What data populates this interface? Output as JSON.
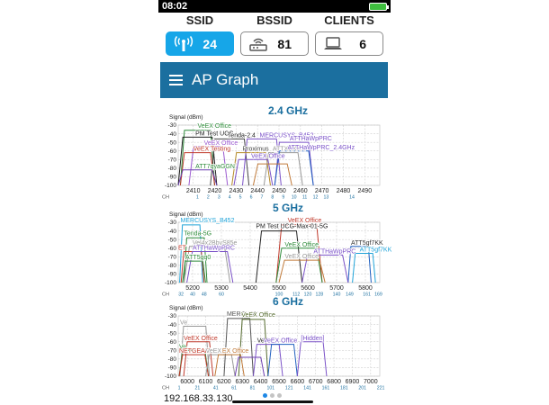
{
  "status": {
    "time": "08:02"
  },
  "counters": [
    {
      "title": "SSID",
      "value": "24",
      "icon": "wifi-signal-icon"
    },
    {
      "title": "BSSID",
      "value": "81",
      "icon": "router-icon"
    },
    {
      "title": "CLIENTS",
      "value": "6",
      "icon": "laptop-icon"
    }
  ],
  "appbar": {
    "title": "AP Graph",
    "menu_icon": "hamburger-menu-icon"
  },
  "colors": {
    "accent": "#16a6e8",
    "appbar": "#1b6f9f",
    "grid": "#cfcfcf"
  },
  "graphs": [
    {
      "title": "2.4 GHz",
      "y_label": "Signal (dBm)",
      "ch_label": "CH",
      "y_ticks": [
        "-30",
        "-40",
        "-50",
        "-60",
        "-70",
        "-80",
        "-90",
        "-100"
      ],
      "x_ticks": [
        "2410",
        "2420",
        "2430",
        "2440",
        "2450",
        "2460",
        "2470",
        "2480",
        "2490"
      ],
      "x_min": 2403,
      "x_max": 2497,
      "x_tick_values": [
        2410,
        2420,
        2430,
        2440,
        2450,
        2460,
        2470,
        2480,
        2490
      ],
      "channels": [
        "1",
        "2",
        "3",
        "4",
        "5",
        "6",
        "7",
        "8",
        "9",
        "10",
        "11",
        "12",
        "13",
        "14"
      ],
      "channel_values": [
        2412,
        2417,
        2422,
        2427,
        2432,
        2437,
        2442,
        2447,
        2452,
        2457,
        2462,
        2467,
        2472,
        2484
      ],
      "labels": [
        {
          "text": "VeEX Office",
          "freq": 2412,
          "dbm": -33,
          "color": "#2e8b3a"
        },
        {
          "text": "PM Test UCG",
          "freq": 2411,
          "dbm": -42,
          "color": "#222222"
        },
        {
          "text": "Tenda-2.4",
          "freq": 2426,
          "dbm": -44,
          "color": "#222222"
        },
        {
          "text": "MERCUSYS_B452",
          "freq": 2441,
          "dbm": -44,
          "color": "#7b52c8"
        },
        {
          "text": "ATTHaWpPRC",
          "freq": 2455,
          "dbm": -48,
          "color": "#7b52c8"
        },
        {
          "text": "VeEX Office",
          "freq": 2415,
          "dbm": -53,
          "color": "#9b59d0"
        },
        {
          "text": "VeEX Testing",
          "freq": 2410,
          "dbm": -60,
          "color": "#c0392b"
        },
        {
          "text": "Proximus",
          "freq": 2433,
          "dbm": -60,
          "color": "#444444"
        },
        {
          "text": "ATTXXXXX",
          "freq": 2447,
          "dbm": -60,
          "color": "#999999"
        },
        {
          "text": "ATTHaWpPRC_2.4GHz",
          "freq": 2454,
          "dbm": -58,
          "color": "#7b52c8"
        },
        {
          "text": "VeEX Office",
          "freq": 2437,
          "dbm": -68,
          "color": "#7b52c8"
        },
        {
          "text": "ATT7qyaGGN",
          "freq": 2411,
          "dbm": -80,
          "color": "#2e8b3a"
        }
      ],
      "curves": [
        {
          "f1": 2404,
          "f2": 2420,
          "dbm": -36,
          "color": "#2e8b3a"
        },
        {
          "f1": 2403,
          "f2": 2421,
          "dbm": -44,
          "color": "#222222"
        },
        {
          "f1": 2418,
          "f2": 2436,
          "dbm": -46,
          "color": "#444444"
        },
        {
          "f1": 2433,
          "f2": 2451,
          "dbm": -46,
          "color": "#7b52c8"
        },
        {
          "f1": 2448,
          "f2": 2466,
          "dbm": -50,
          "color": "#7b52c8"
        },
        {
          "f1": 2408,
          "f2": 2426,
          "dbm": -55,
          "color": "#9b59d0"
        },
        {
          "f1": 2404,
          "f2": 2420,
          "dbm": -62,
          "color": "#c0392b"
        },
        {
          "f1": 2428,
          "f2": 2446,
          "dbm": -62,
          "color": "#b58b2a"
        },
        {
          "f1": 2443,
          "f2": 2461,
          "dbm": -62,
          "color": "#999999"
        },
        {
          "f1": 2448,
          "f2": 2466,
          "dbm": -60,
          "color": "#1f5fbf"
        },
        {
          "f1": 2429,
          "f2": 2447,
          "dbm": -70,
          "color": "#7b52c8"
        },
        {
          "f1": 2403,
          "f2": 2421,
          "dbm": -82,
          "color": "#6c3fb0"
        },
        {
          "f1": 2438,
          "f2": 2456,
          "dbm": -75,
          "color": "#c07a3a"
        }
      ]
    },
    {
      "title": "5 GHz",
      "y_label": "Signal (dBm)",
      "ch_label": "CH",
      "y_ticks": [
        "-30",
        "-40",
        "-50",
        "-60",
        "-70",
        "-80",
        "-90",
        "-100"
      ],
      "x_ticks": [
        "5200",
        "5300",
        "5400",
        "5500",
        "5600",
        "5700",
        "5800"
      ],
      "x_min": 5150,
      "x_max": 5850,
      "x_tick_values": [
        5200,
        5300,
        5400,
        5500,
        5600,
        5700,
        5800
      ],
      "channels": [
        "32",
        "40",
        "48",
        "60",
        "100",
        "112",
        "120",
        "128",
        "140",
        "149",
        "161",
        "169"
      ],
      "channel_values": [
        5160,
        5200,
        5240,
        5300,
        5500,
        5560,
        5600,
        5640,
        5700,
        5745,
        5805,
        5845
      ],
      "labels": [
        {
          "text": "MERCUSYS_B452",
          "freq": 5158,
          "dbm": -30,
          "color": "#1fa3d8"
        },
        {
          "text": "VeEX Office",
          "freq": 5530,
          "dbm": -30,
          "color": "#c0392b"
        },
        {
          "text": "PM Test UCG-Max-01-5G",
          "freq": 5420,
          "dbm": -37,
          "color": "#222222"
        },
        {
          "text": "Tenda-5G",
          "freq": 5170,
          "dbm": -45,
          "color": "#2e8b3a"
        },
        {
          "text": "Vel4x2BbvS85e",
          "freq": 5200,
          "dbm": -56,
          "color": "#999999"
        },
        {
          "text": "VeEX Office",
          "freq": 5520,
          "dbm": -58,
          "color": "#2e8b3a"
        },
        {
          "text": "ATT5gf7KK",
          "freq": 5750,
          "dbm": -56,
          "color": "#333333"
        },
        {
          "text": "ET",
          "freq": 5150,
          "dbm": -62,
          "color": "#c0392b"
        },
        {
          "text": "ATTHaWpPRC",
          "freq": 5200,
          "dbm": -62,
          "color": "#7b52c8"
        },
        {
          "text": "ATTHaWpPRC",
          "freq": 5620,
          "dbm": -66,
          "color": "#7b52c8"
        },
        {
          "text": "VeEX Office",
          "freq": 5520,
          "dbm": -72,
          "color": "#999999"
        },
        {
          "text": "ATT5gf7KK",
          "freq": 5780,
          "dbm": -64,
          "color": "#1fa3d8"
        },
        {
          "text": "ATT5gq0",
          "freq": 5175,
          "dbm": -73,
          "color": "#2e8b3a"
        }
      ],
      "curves": [
        {
          "f1": 5155,
          "f2": 5235,
          "dbm": -33,
          "color": "#1fa3d8"
        },
        {
          "f1": 5490,
          "f2": 5650,
          "dbm": -33,
          "color": "#c0392b"
        },
        {
          "f1": 5420,
          "f2": 5580,
          "dbm": -40,
          "color": "#222222"
        },
        {
          "f1": 5170,
          "f2": 5250,
          "dbm": -48,
          "color": "#2e8b3a"
        },
        {
          "f1": 5170,
          "f2": 5330,
          "dbm": -58,
          "color": "#999999"
        },
        {
          "f1": 5490,
          "f2": 5650,
          "dbm": -60,
          "color": "#2e8b3a"
        },
        {
          "f1": 5740,
          "f2": 5820,
          "dbm": -58,
          "color": "#1f5fbf"
        },
        {
          "f1": 5160,
          "f2": 5240,
          "dbm": -64,
          "color": "#c0392b"
        },
        {
          "f1": 5180,
          "f2": 5340,
          "dbm": -64,
          "color": "#7b52c8"
        },
        {
          "f1": 5580,
          "f2": 5740,
          "dbm": -68,
          "color": "#7b52c8"
        },
        {
          "f1": 5500,
          "f2": 5660,
          "dbm": -74,
          "color": "#c07a3a"
        },
        {
          "f1": 5755,
          "f2": 5835,
          "dbm": -66,
          "color": "#1fa3d8"
        },
        {
          "f1": 5165,
          "f2": 5245,
          "dbm": -75,
          "color": "#2e8b3a"
        }
      ]
    },
    {
      "title": "6 GHz",
      "y_label": "Signal (dBm)",
      "ch_label": "CH",
      "y_ticks": [
        "-30",
        "-40",
        "-50",
        "-60",
        "-70",
        "-80",
        "-90",
        "-100"
      ],
      "x_ticks": [
        "6000",
        "6100",
        "6200",
        "6300",
        "6400",
        "6500",
        "6600",
        "6700",
        "6800",
        "6900",
        "7000"
      ],
      "x_min": 5950,
      "x_max": 7050,
      "x_tick_values": [
        6000,
        6100,
        6200,
        6300,
        6400,
        6500,
        6600,
        6700,
        6800,
        6900,
        7000
      ],
      "channels": [
        "1",
        "21",
        "41",
        "61",
        "81",
        "101",
        "121",
        "141",
        "161",
        "181",
        "201",
        "221"
      ],
      "channel_values": [
        5955,
        6055,
        6155,
        6255,
        6355,
        6455,
        6555,
        6655,
        6755,
        6855,
        6955,
        7055
      ],
      "labels": [
        {
          "text": "MERCUSY",
          "freq": 6215,
          "dbm": -30,
          "color": "#555555"
        },
        {
          "text": "VeEX Office",
          "freq": 6295,
          "dbm": -31,
          "color": "#556b2f"
        },
        {
          "text": "Ve",
          "freq": 5960,
          "dbm": -40,
          "color": "#999999"
        },
        {
          "text": "VeEX Office",
          "freq": 5980,
          "dbm": -58,
          "color": "#c0392b"
        },
        {
          "text": "Ve",
          "freq": 6380,
          "dbm": -61,
          "color": "#222222"
        },
        {
          "text": "VeEX Office",
          "freq": 6415,
          "dbm": -61,
          "color": "#7b52c8"
        },
        {
          "text": "[Hidden]",
          "freq": 6620,
          "dbm": -58,
          "color": "#7b52c8"
        },
        {
          "text": "Ve",
          "freq": 5955,
          "dbm": -68,
          "color": "#2e8b3a"
        },
        {
          "text": "NETGEAR",
          "freq": 5955,
          "dbm": -73,
          "color": "#c0392b"
        },
        {
          "text": "VeEX",
          "freq": 6100,
          "dbm": -73,
          "color": "#999999"
        },
        {
          "text": "EX Office",
          "freq": 6190,
          "dbm": -73,
          "color": "#c07a3a"
        }
      ],
      "curves": [
        {
          "f1": 6200,
          "f2": 6360,
          "dbm": -33,
          "color": "#555555"
        },
        {
          "f1": 6280,
          "f2": 6440,
          "dbm": -34,
          "color": "#556b2f"
        },
        {
          "f1": 5960,
          "f2": 6120,
          "dbm": -42,
          "color": "#999999"
        },
        {
          "f1": 5980,
          "f2": 6140,
          "dbm": -60,
          "color": "#c0392b"
        },
        {
          "f1": 6360,
          "f2": 6520,
          "dbm": -63,
          "color": "#7b52c8"
        },
        {
          "f1": 6440,
          "f2": 6600,
          "dbm": -63,
          "color": "#1f5fbf"
        },
        {
          "f1": 6600,
          "f2": 6760,
          "dbm": -60,
          "color": "#7b52c8"
        },
        {
          "f1": 5955,
          "f2": 6115,
          "dbm": -70,
          "color": "#2e8b3a"
        },
        {
          "f1": 5955,
          "f2": 6115,
          "dbm": -75,
          "color": "#c0392b"
        },
        {
          "f1": 6100,
          "f2": 6260,
          "dbm": -75,
          "color": "#999999"
        },
        {
          "f1": 6150,
          "f2": 6310,
          "dbm": -75,
          "color": "#c07a3a"
        },
        {
          "f1": 6260,
          "f2": 6420,
          "dbm": -78,
          "color": "#6c3fb0"
        }
      ]
    }
  ],
  "footer": {
    "ip": "192.168.33.130",
    "page_indicator": {
      "count": 3,
      "active": 0
    }
  }
}
